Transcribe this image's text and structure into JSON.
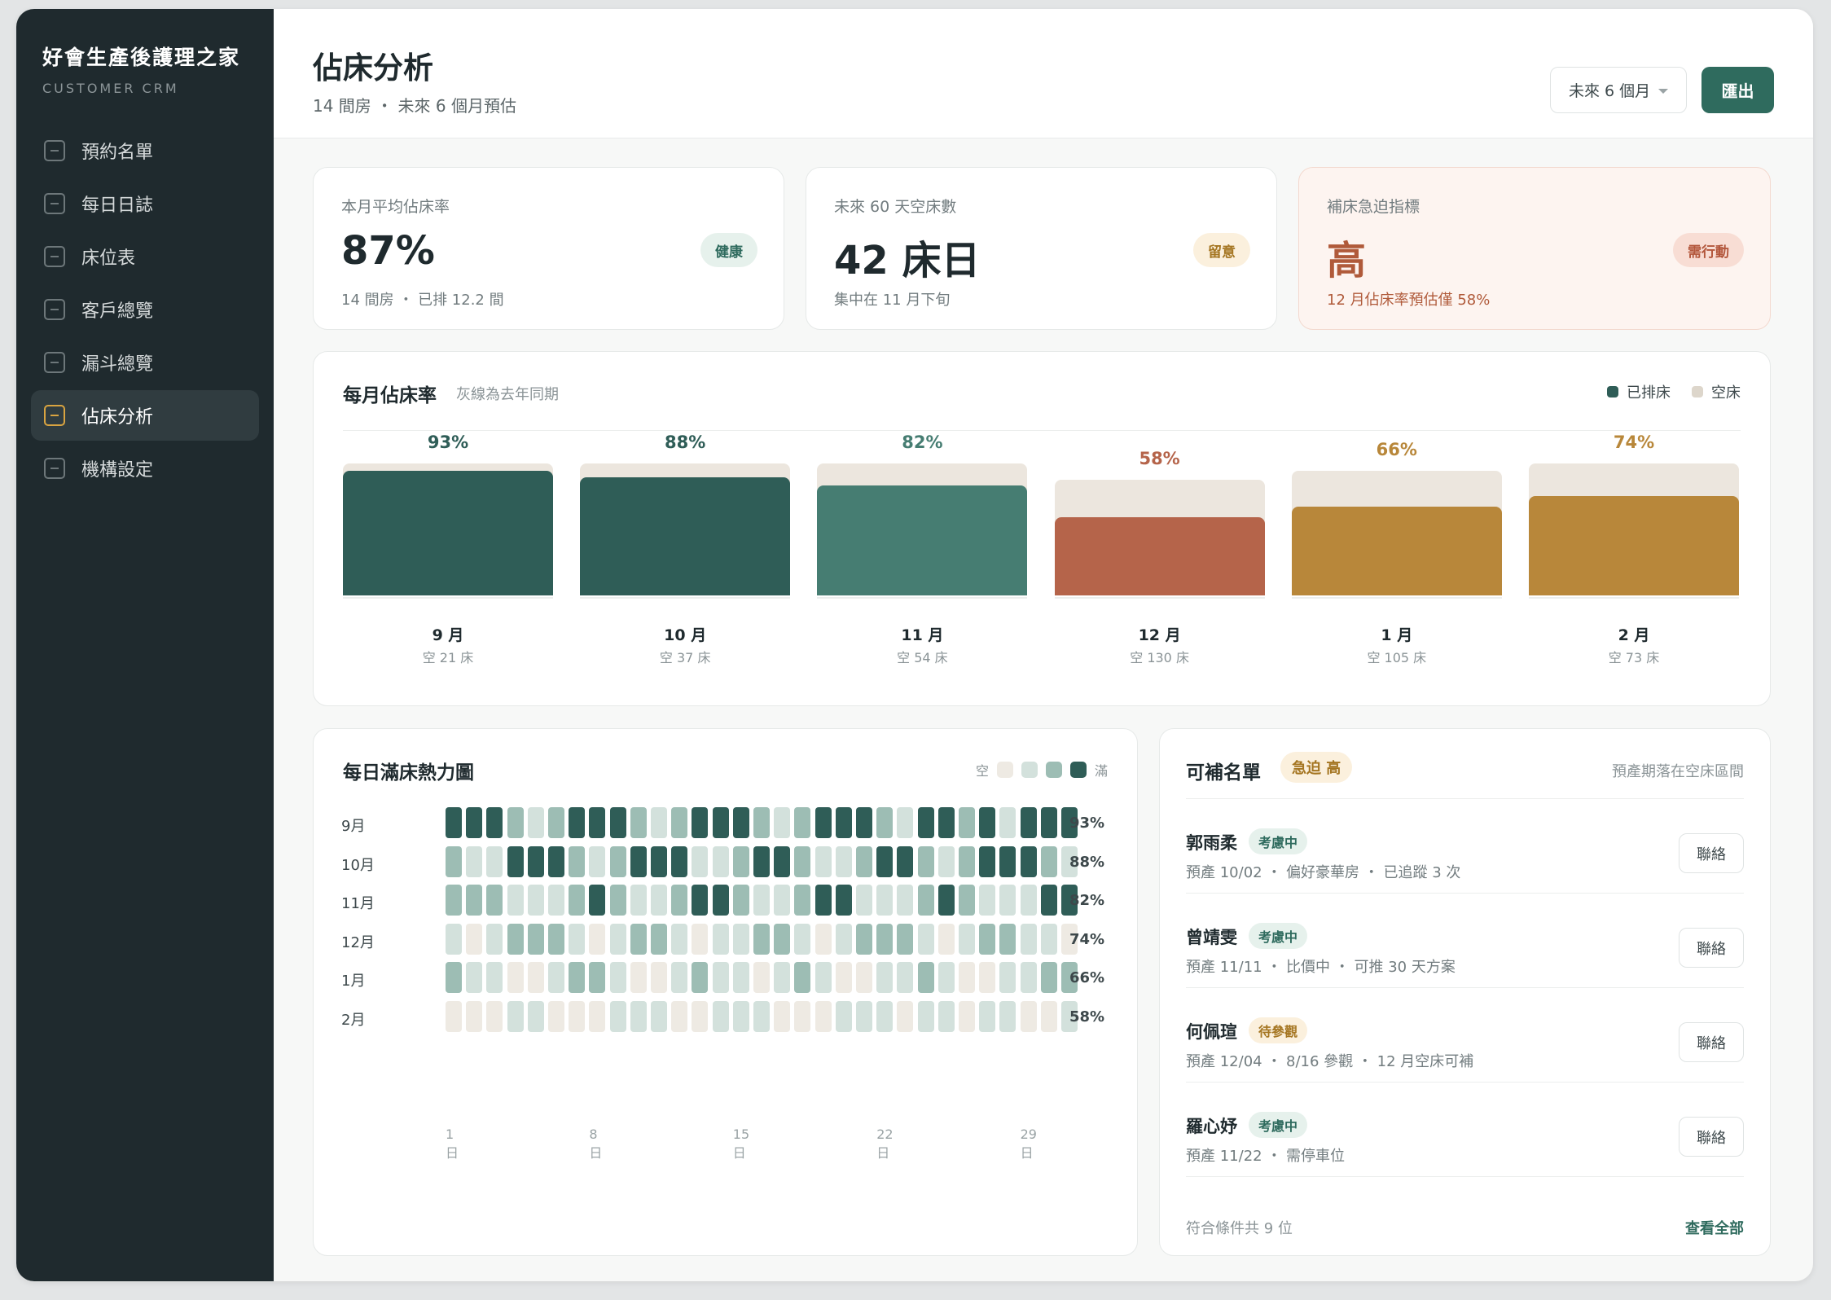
{
  "sidebar": {
    "brand": "好會生產後護理之家",
    "brand_sub": "CUSTOMER CRM",
    "items": [
      {
        "label": "預約名單",
        "active": false
      },
      {
        "label": "每日日誌",
        "active": false
      },
      {
        "label": "床位表",
        "active": false
      },
      {
        "label": "客戶總覽",
        "active": false
      },
      {
        "label": "漏斗總覽",
        "active": false
      },
      {
        "label": "佔床分析",
        "active": true
      },
      {
        "label": "機構設定",
        "active": false
      }
    ]
  },
  "header": {
    "title": "佔床分析",
    "subtitle": "14 間房 ・ 未來 6 個月預估",
    "range": "未來 6 個月",
    "export_label": "匯出"
  },
  "kpis": [
    {
      "label": "本月平均佔床率",
      "value": "87%",
      "note": "14 間房 ・ 已排 12.2 間",
      "badge": "健康",
      "tone": "good"
    },
    {
      "label": "未來 60 天空床數",
      "value": "42 床日",
      "note": "集中在 11 月下旬",
      "badge": "留意",
      "tone": "warn"
    },
    {
      "label": "補床急迫指標",
      "value": "高",
      "note": "12 月佔床率預估僅 58%",
      "badge": "需行動",
      "tone": "bad"
    }
  ],
  "monthly": {
    "title": "每月佔床率",
    "note": "灰線為去年同期",
    "legend_booked": "已排床",
    "legend_empty": "空床"
  },
  "chart_data": {
    "type": "bar",
    "title": "每月佔床率",
    "categories": [
      "9 月",
      "10 月",
      "11 月",
      "12 月",
      "1 月",
      "2 月"
    ],
    "values": [
      93,
      88,
      82,
      58,
      66,
      74
    ],
    "value_labels": [
      "93%",
      "88%",
      "82%",
      "58%",
      "66%",
      "74%"
    ],
    "last_year": [
      98,
      98,
      98,
      86,
      93,
      98
    ],
    "empty_beds": [
      "空 21 床",
      "空 37 床",
      "空 54 床",
      "空 130 床",
      "空 105 床",
      "空 73 床"
    ],
    "ylim": [
      0,
      100
    ],
    "colors": [
      "#2f5d57",
      "#2f5d57",
      "#467d72",
      "#b5644a",
      "#b8873a",
      "#b8873a"
    ],
    "label_colors": [
      "#2f5d57",
      "#2f5d57",
      "#467d72",
      "#b5644a",
      "#b8873a",
      "#b8873a"
    ]
  },
  "heatmap": {
    "title": "每日滿床熱力圖",
    "legend_low": "空",
    "legend_high": "滿",
    "palette": [
      "#eeeae3",
      "#d3e1dc",
      "#9dbdb4",
      "#2f5d57"
    ],
    "axis_labels": [
      "1 日",
      "8 日",
      "15 日",
      "22 日",
      "29 日"
    ],
    "rows": [
      {
        "month": "9月",
        "pct": "93%",
        "levels": [
          4,
          4,
          4,
          3,
          2,
          3,
          4,
          4,
          4,
          3,
          2,
          3,
          4,
          4,
          4,
          3,
          2,
          3,
          4,
          4,
          4,
          3,
          2,
          4,
          4,
          3,
          4,
          2,
          4,
          4,
          4
        ]
      },
      {
        "month": "10月",
        "pct": "88%",
        "levels": [
          3,
          2,
          2,
          4,
          4,
          4,
          3,
          2,
          3,
          4,
          4,
          4,
          2,
          2,
          3,
          4,
          4,
          3,
          2,
          2,
          3,
          4,
          4,
          3,
          2,
          3,
          4,
          4,
          4,
          3,
          2
        ]
      },
      {
        "month": "11月",
        "pct": "82%",
        "levels": [
          3,
          3,
          3,
          2,
          2,
          2,
          3,
          4,
          3,
          2,
          2,
          3,
          4,
          4,
          3,
          2,
          2,
          3,
          4,
          4,
          2,
          2,
          2,
          3,
          4,
          3,
          2,
          2,
          2,
          4,
          4
        ]
      },
      {
        "month": "12月",
        "pct": "74%",
        "levels": [
          2,
          1,
          2,
          3,
          3,
          3,
          2,
          1,
          2,
          3,
          3,
          2,
          1,
          2,
          2,
          3,
          3,
          2,
          1,
          2,
          3,
          3,
          3,
          2,
          1,
          2,
          3,
          3,
          2,
          2,
          1
        ]
      },
      {
        "month": "1月",
        "pct": "66%",
        "levels": [
          3,
          2,
          2,
          1,
          1,
          2,
          3,
          3,
          2,
          1,
          1,
          2,
          3,
          2,
          2,
          1,
          2,
          3,
          2,
          1,
          1,
          2,
          2,
          3,
          2,
          1,
          1,
          2,
          2,
          3,
          3
        ]
      },
      {
        "month": "2月",
        "pct": "58%",
        "levels": [
          1,
          1,
          1,
          2,
          2,
          1,
          1,
          1,
          2,
          2,
          2,
          1,
          1,
          2,
          2,
          2,
          1,
          1,
          1,
          2,
          2,
          2,
          1,
          2,
          2,
          1,
          2,
          2,
          1,
          1,
          2
        ]
      }
    ]
  },
  "candidates": {
    "title": "可補名單",
    "urgency": "急迫 高",
    "note": "預產期落在空床區間",
    "items": [
      {
        "name": "郭雨柔",
        "status": "考慮中",
        "tone": "consider",
        "detail": "預產 10/02 ・ 偏好豪華房 ・ 已追蹤 3 次"
      },
      {
        "name": "曾靖雯",
        "status": "考慮中",
        "tone": "consider",
        "detail": "預產 11/11 ・ 比價中 ・ 可推 30 天方案"
      },
      {
        "name": "何佩瑄",
        "status": "待參觀",
        "tone": "visit",
        "detail": "預產 12/04 ・ 8/16 參觀 ・ 12 月空床可補"
      },
      {
        "name": "羅心妤",
        "status": "考慮中",
        "tone": "consider",
        "detail": "預產 11/22 ・ 需停車位"
      }
    ],
    "contact_label": "聯絡",
    "footer": "符合條件共 9 位",
    "view_all": "查看全部"
  }
}
